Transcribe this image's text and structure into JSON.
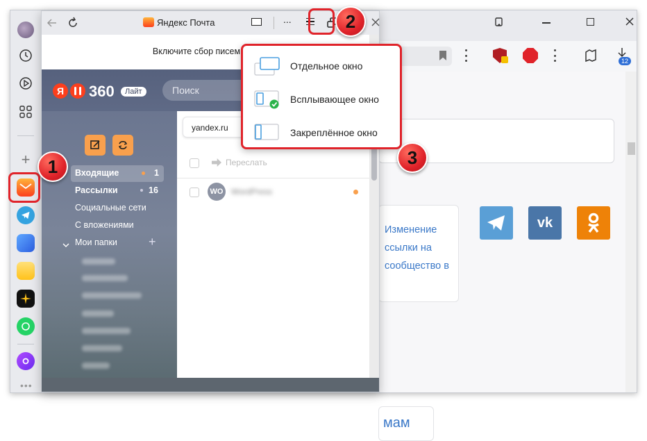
{
  "panel": {
    "title": "Яндекс Почта",
    "notice": "Включите сбор писем из дру",
    "logo_text": "360",
    "logo_ya": "Я",
    "lite_badge": "Лайт",
    "search_placeholder": "Поиск",
    "domain_chip": "yandex.ru",
    "forward_label": "Переслать",
    "folders": [
      {
        "label": "Входящие",
        "count": "1"
      },
      {
        "label": "Рассылки",
        "count": "16"
      },
      {
        "label": "Социальные сети",
        "count": ""
      },
      {
        "label": "С вложениями",
        "count": ""
      },
      {
        "label": "Мои папки",
        "count": ""
      }
    ],
    "mail_row": {
      "avatar": "WO",
      "sender": "WordPress"
    }
  },
  "menu": {
    "items": [
      {
        "label": "Отдельное окно",
        "icon": "separate-window-icon"
      },
      {
        "label": "Всплывающее окно",
        "icon": "popup-window-icon"
      },
      {
        "label": "Закреплённое окно",
        "icon": "docked-window-icon"
      }
    ]
  },
  "badges": {
    "one": "1",
    "two": "2",
    "three": "3"
  },
  "browser": {
    "download_count": "12",
    "card_text": "Изменение ссылки на сообщество в",
    "partial_text": "мам"
  },
  "colors": {
    "accent_red": "#e0232a",
    "mail_orange": "#fc3f1d",
    "vk": "#4a76a8",
    "ok": "#ee8208",
    "telegram": "#5a9fd6"
  }
}
